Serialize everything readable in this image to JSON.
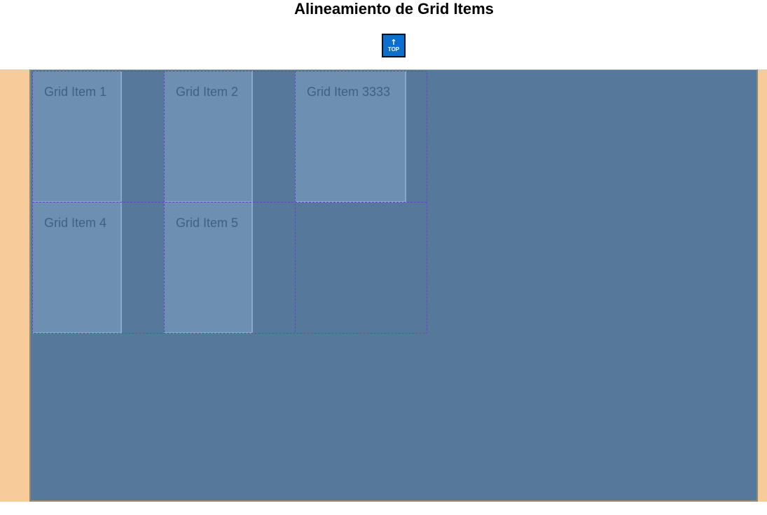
{
  "page": {
    "title": "Alineamiento de Grid Items"
  },
  "top_button": {
    "arrow": "↑",
    "label": "TOP"
  },
  "grid": {
    "items": [
      {
        "label": "Grid Item 1"
      },
      {
        "label": "Grid Item 2"
      },
      {
        "label": "Grid Item 3333"
      },
      {
        "label": "Grid Item 4"
      },
      {
        "label": "Grid Item 5"
      }
    ]
  },
  "colors": {
    "band": "#f7cb9a",
    "container": "#56799b",
    "item": "#6d8fb2",
    "grid_line": "#6a3fd0",
    "top_button": "#0b6fd0"
  }
}
